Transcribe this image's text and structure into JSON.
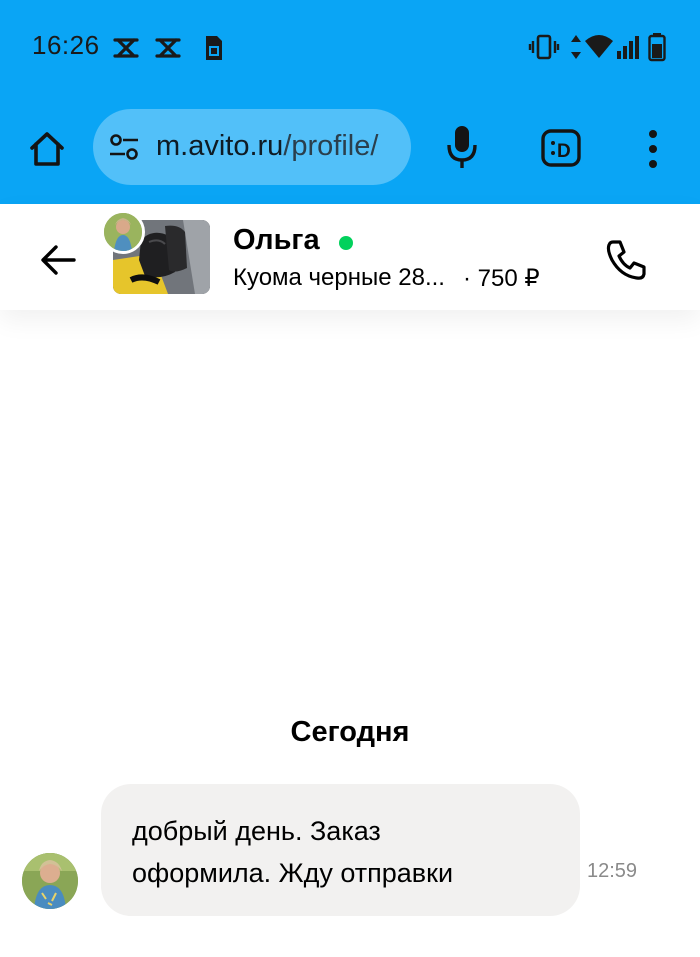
{
  "status_bar": {
    "time": "16:26",
    "left_icons": [
      "capcut-icon",
      "capcut-icon",
      "sim-card-icon"
    ],
    "right_icons": [
      "vibrate-icon",
      "data-arrows-icon",
      "wifi-icon",
      "signal-icon",
      "battery-icon"
    ]
  },
  "browser": {
    "url_host": "m.avito.ru",
    "url_path": "/profile/",
    "colors": {
      "toolbar": "#0AA5F5",
      "url_field": "#52C0F9"
    }
  },
  "chat": {
    "seller_name": "Ольга",
    "online": true,
    "item_title": "Куома черные 28...",
    "item_price": "· 750 ₽",
    "date_separator": "Сегодня",
    "messages": [
      {
        "text_line1": "добрый день. Заказ",
        "text_line2": "оформила. Жду отправки",
        "time": "12:59",
        "incoming": true
      }
    ],
    "colors": {
      "online": "#02D15C",
      "bubble": "#F2F1F0"
    }
  }
}
